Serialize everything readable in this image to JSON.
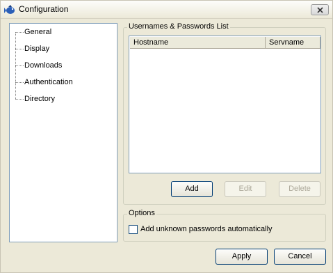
{
  "window": {
    "title": "Configuration",
    "icon": "app-fish-icon",
    "close_icon": "close-icon"
  },
  "sidebar": {
    "items": [
      {
        "label": "General"
      },
      {
        "label": "Display"
      },
      {
        "label": "Downloads"
      },
      {
        "label": "Authentication"
      },
      {
        "label": "Directory"
      }
    ]
  },
  "credentials": {
    "group_title": "Usernames & Passwords List",
    "columns": [
      "Hostname",
      "Servname"
    ],
    "rows": [],
    "add_label": "Add",
    "edit_label": "Edit",
    "delete_label": "Delete"
  },
  "options": {
    "group_title": "Options",
    "auto_add_label": "Add unknown passwords automatically",
    "auto_add_checked": false
  },
  "footer": {
    "apply_label": "Apply",
    "cancel_label": "Cancel"
  },
  "colors": {
    "window_bg": "#ece9d8",
    "border_blue": "#7f9db9",
    "button_border": "#003c74",
    "disabled_text": "#aca899"
  }
}
